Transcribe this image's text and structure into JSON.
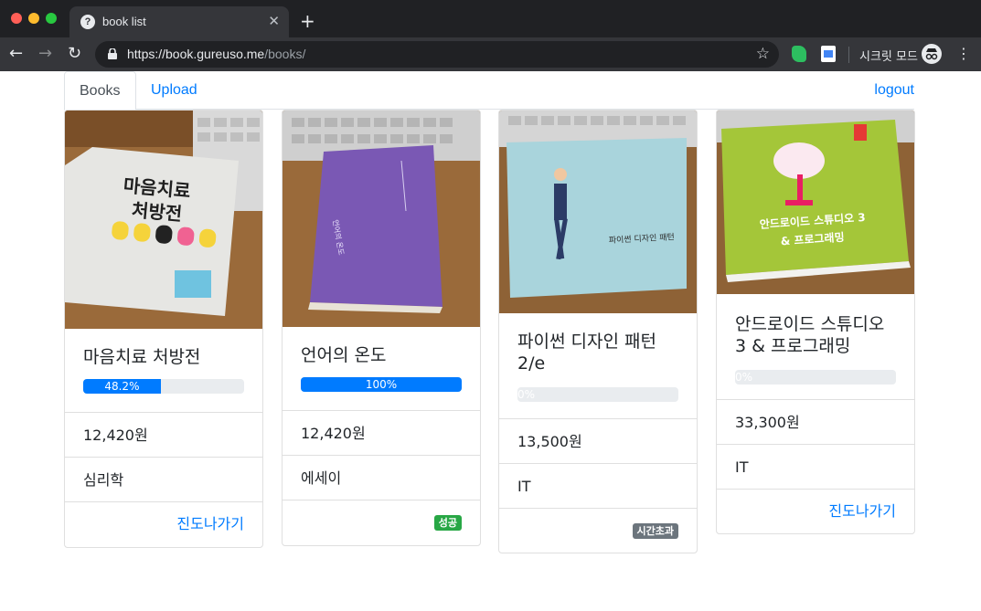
{
  "browser": {
    "tab_title": "book list",
    "tab_favicon": "?",
    "url_host": "https://book.gureuso.me",
    "url_path": "/books/",
    "incognito_label": "시크릿 모드"
  },
  "nav": {
    "books_label": "Books",
    "upload_label": "Upload",
    "logout_label": "logout"
  },
  "colors": {
    "primary": "#007bff",
    "success": "#28a745",
    "secondary": "#6c757d"
  },
  "books": [
    {
      "title": "마음치료 처방전",
      "progress_text": "48.2%",
      "progress": 48.2,
      "price": "12,420원",
      "category": "심리학",
      "action_label": "진도나가기",
      "status_badge": "",
      "cover_text": "마음치료\n처방전"
    },
    {
      "title": "언어의 온도",
      "progress_text": "100%",
      "progress": 100,
      "price": "12,420원",
      "category": "에세이",
      "action_label": "",
      "status_badge": "성공",
      "cover_text": "언어의 온도"
    },
    {
      "title": "파이썬 디자인 패턴 2/e",
      "progress_text": "0%",
      "progress": 0,
      "price": "13,500원",
      "category": "IT",
      "action_label": "",
      "status_badge": "시간초과",
      "cover_text": "파이썬 디자인 패턴"
    },
    {
      "title": "안드로이드 스튜디오 3 & 프로그래밍",
      "progress_text": "0%",
      "progress": 0,
      "price": "33,300원",
      "category": "IT",
      "action_label": "진도나가기",
      "status_badge": "",
      "cover_text": "안드로이드 스튜디오 3\n& 프로그래밍"
    }
  ]
}
